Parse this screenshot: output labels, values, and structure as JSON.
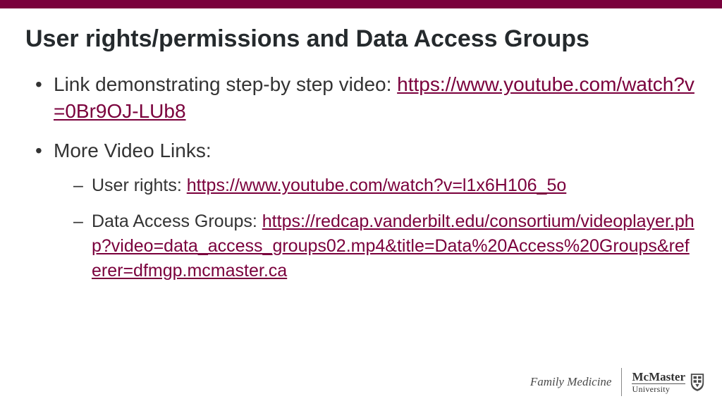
{
  "title": "User rights/permissions and Data Access Groups",
  "bullets": [
    {
      "text": "Link demonstrating step-by step video: ",
      "link": "https://www.youtube.com/watch?v=0Br9OJ-LUb8"
    },
    {
      "text": "More Video Links:",
      "sub": [
        {
          "text": "User rights: ",
          "link": "https://www.youtube.com/watch?v=l1x6H106_5o"
        },
        {
          "text": "Data Access Groups: ",
          "link": "https://redcap.vanderbilt.edu/consortium/videoplayer.php?video=data_access_groups02.mp4&title=Data%20Access%20Groups&referer=dfmgp.mcmaster.ca"
        }
      ]
    }
  ],
  "footer": {
    "department": "Family Medicine",
    "brand_name": "McMaster",
    "brand_sub": "University"
  }
}
